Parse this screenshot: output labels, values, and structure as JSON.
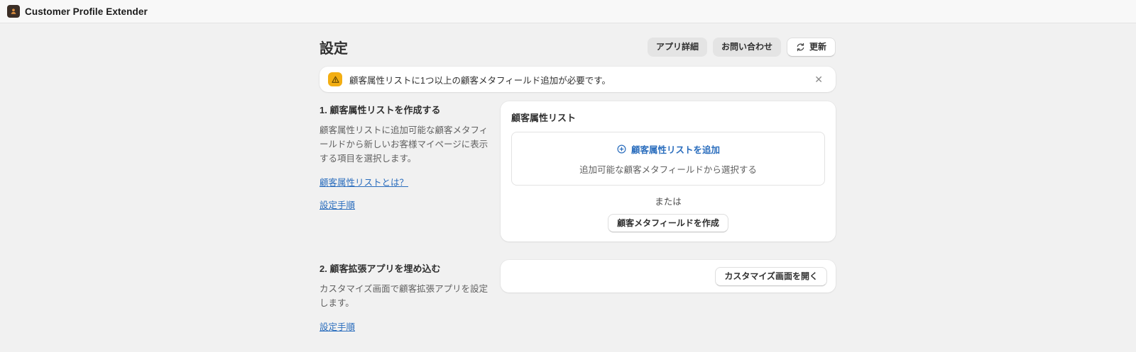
{
  "topbar": {
    "app_title": "Customer Profile Extender"
  },
  "page": {
    "title": "設定",
    "actions": {
      "app_details": "アプリ詳細",
      "contact": "お問い合わせ",
      "refresh": "更新"
    }
  },
  "banner": {
    "message": "顧客属性リストに1つ以上の顧客メタフィールド追加が必要です。",
    "close_glyph": "✕"
  },
  "sections": [
    {
      "heading": "1. 顧客属性リストを作成する",
      "description": "顧客属性リストに追加可能な顧客メタフィールドから新しいお客様マイページに表示する項目を選択します。",
      "links": [
        "顧客属性リストとは？",
        "設定手順"
      ],
      "card": {
        "title": "顧客属性リスト",
        "add_link": "顧客属性リストを追加",
        "add_hint": "追加可能な顧客メタフィールドから選択する",
        "or_text": "または",
        "create_button": "顧客メタフィールドを作成"
      }
    },
    {
      "heading": "2. 顧客拡張アプリを埋め込む",
      "description": "カスタマイズ画面で顧客拡張アプリを設定します。",
      "links": [
        "設定手順"
      ],
      "card": {
        "open_button": "カスタマイズ画面を開く"
      }
    }
  ],
  "icons": {
    "app": "person-badge",
    "warning": "triangle-exclamation",
    "refresh": "circular-arrows",
    "add": "plus-circle",
    "close": "x-mark"
  },
  "colors": {
    "link_blue": "#2a6dbd",
    "warning_yellow": "#f3ae12",
    "warning_glyph": "#5f4300",
    "page_bg": "#f1f1f1",
    "topbar_bg": "#f8f8f8",
    "card_bg": "#ffffff",
    "text_primary": "#303030",
    "text_secondary": "#616161"
  }
}
